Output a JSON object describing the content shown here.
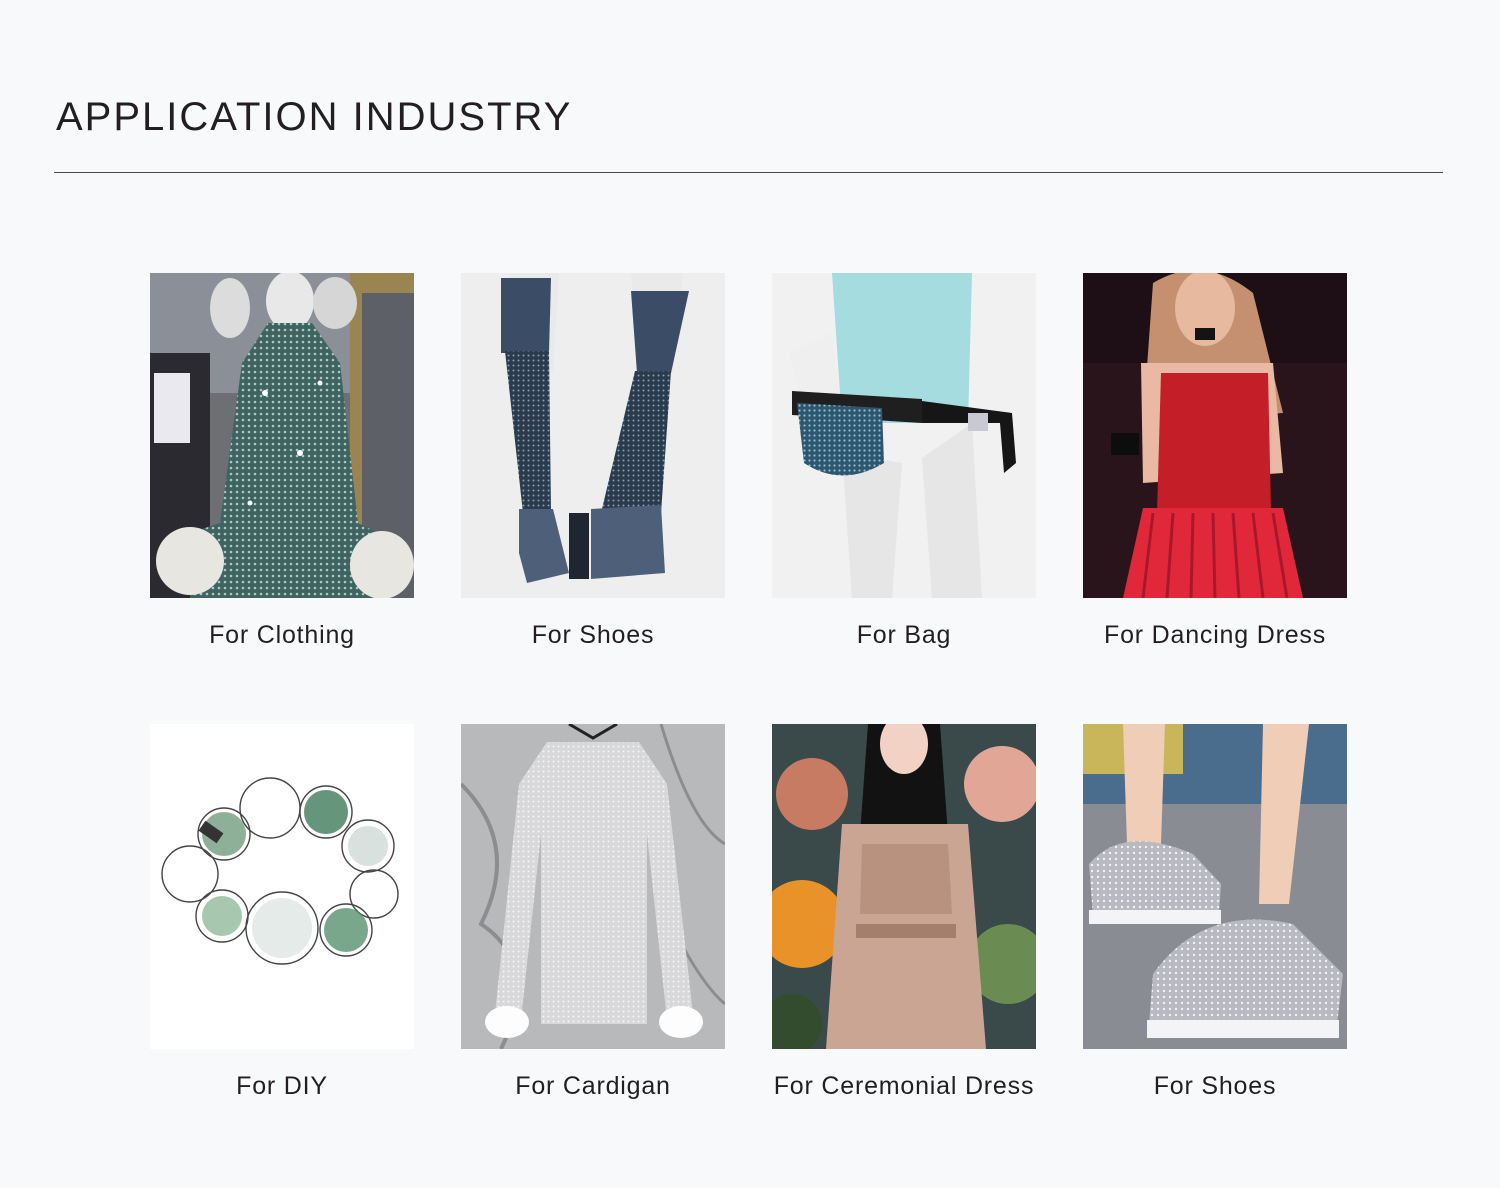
{
  "page": {
    "title": "APPLICATION INDUSTRY"
  },
  "items": [
    {
      "caption": "For Clothing",
      "photo": "sparkly-mesh-dress-photo"
    },
    {
      "caption": "For Shoes",
      "photo": "rhinestone-boots-photo"
    },
    {
      "caption": "For Bag",
      "photo": "rhinestone-waist-bag-photo"
    },
    {
      "caption": "For Dancing Dress",
      "photo": "red-dancing-dress-photo"
    },
    {
      "caption": "For DIY",
      "photo": "beaded-bracelet-photo"
    },
    {
      "caption": "For Cardigan",
      "photo": "mesh-cardigan-photo"
    },
    {
      "caption": "For Ceremonial Dress",
      "photo": "ceremonial-dress-photo"
    },
    {
      "caption": "For Shoes",
      "photo": "sparkly-sneakers-photo"
    }
  ],
  "colors": {
    "background": "#f8f9fb",
    "text": "#231f20",
    "rule": "#4a4a4a"
  }
}
